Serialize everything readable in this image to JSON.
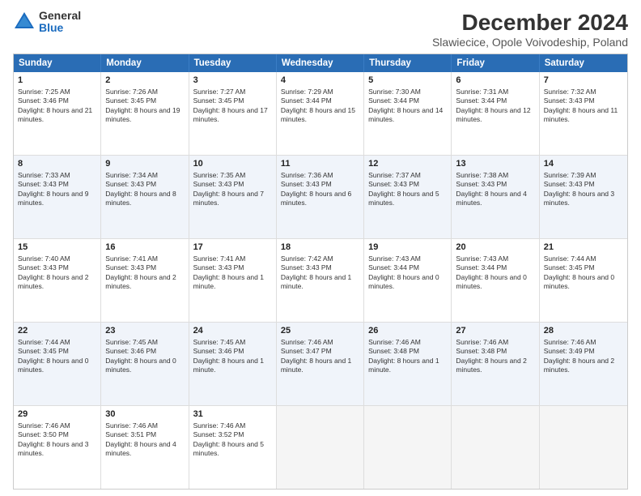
{
  "header": {
    "logo_general": "General",
    "logo_blue": "Blue",
    "main_title": "December 2024",
    "subtitle": "Slawiecice, Opole Voivodeship, Poland"
  },
  "calendar": {
    "days_of_week": [
      "Sunday",
      "Monday",
      "Tuesday",
      "Wednesday",
      "Thursday",
      "Friday",
      "Saturday"
    ],
    "rows": [
      {
        "alt": false,
        "cells": [
          {
            "day": "1",
            "text": "Sunrise: 7:25 AM\nSunset: 3:46 PM\nDaylight: 8 hours and 21 minutes."
          },
          {
            "day": "2",
            "text": "Sunrise: 7:26 AM\nSunset: 3:45 PM\nDaylight: 8 hours and 19 minutes."
          },
          {
            "day": "3",
            "text": "Sunrise: 7:27 AM\nSunset: 3:45 PM\nDaylight: 8 hours and 17 minutes."
          },
          {
            "day": "4",
            "text": "Sunrise: 7:29 AM\nSunset: 3:44 PM\nDaylight: 8 hours and 15 minutes."
          },
          {
            "day": "5",
            "text": "Sunrise: 7:30 AM\nSunset: 3:44 PM\nDaylight: 8 hours and 14 minutes."
          },
          {
            "day": "6",
            "text": "Sunrise: 7:31 AM\nSunset: 3:44 PM\nDaylight: 8 hours and 12 minutes."
          },
          {
            "day": "7",
            "text": "Sunrise: 7:32 AM\nSunset: 3:43 PM\nDaylight: 8 hours and 11 minutes."
          }
        ]
      },
      {
        "alt": true,
        "cells": [
          {
            "day": "8",
            "text": "Sunrise: 7:33 AM\nSunset: 3:43 PM\nDaylight: 8 hours and 9 minutes."
          },
          {
            "day": "9",
            "text": "Sunrise: 7:34 AM\nSunset: 3:43 PM\nDaylight: 8 hours and 8 minutes."
          },
          {
            "day": "10",
            "text": "Sunrise: 7:35 AM\nSunset: 3:43 PM\nDaylight: 8 hours and 7 minutes."
          },
          {
            "day": "11",
            "text": "Sunrise: 7:36 AM\nSunset: 3:43 PM\nDaylight: 8 hours and 6 minutes."
          },
          {
            "day": "12",
            "text": "Sunrise: 7:37 AM\nSunset: 3:43 PM\nDaylight: 8 hours and 5 minutes."
          },
          {
            "day": "13",
            "text": "Sunrise: 7:38 AM\nSunset: 3:43 PM\nDaylight: 8 hours and 4 minutes."
          },
          {
            "day": "14",
            "text": "Sunrise: 7:39 AM\nSunset: 3:43 PM\nDaylight: 8 hours and 3 minutes."
          }
        ]
      },
      {
        "alt": false,
        "cells": [
          {
            "day": "15",
            "text": "Sunrise: 7:40 AM\nSunset: 3:43 PM\nDaylight: 8 hours and 2 minutes."
          },
          {
            "day": "16",
            "text": "Sunrise: 7:41 AM\nSunset: 3:43 PM\nDaylight: 8 hours and 2 minutes."
          },
          {
            "day": "17",
            "text": "Sunrise: 7:41 AM\nSunset: 3:43 PM\nDaylight: 8 hours and 1 minute."
          },
          {
            "day": "18",
            "text": "Sunrise: 7:42 AM\nSunset: 3:43 PM\nDaylight: 8 hours and 1 minute."
          },
          {
            "day": "19",
            "text": "Sunrise: 7:43 AM\nSunset: 3:44 PM\nDaylight: 8 hours and 0 minutes."
          },
          {
            "day": "20",
            "text": "Sunrise: 7:43 AM\nSunset: 3:44 PM\nDaylight: 8 hours and 0 minutes."
          },
          {
            "day": "21",
            "text": "Sunrise: 7:44 AM\nSunset: 3:45 PM\nDaylight: 8 hours and 0 minutes."
          }
        ]
      },
      {
        "alt": true,
        "cells": [
          {
            "day": "22",
            "text": "Sunrise: 7:44 AM\nSunset: 3:45 PM\nDaylight: 8 hours and 0 minutes."
          },
          {
            "day": "23",
            "text": "Sunrise: 7:45 AM\nSunset: 3:46 PM\nDaylight: 8 hours and 0 minutes."
          },
          {
            "day": "24",
            "text": "Sunrise: 7:45 AM\nSunset: 3:46 PM\nDaylight: 8 hours and 1 minute."
          },
          {
            "day": "25",
            "text": "Sunrise: 7:46 AM\nSunset: 3:47 PM\nDaylight: 8 hours and 1 minute."
          },
          {
            "day": "26",
            "text": "Sunrise: 7:46 AM\nSunset: 3:48 PM\nDaylight: 8 hours and 1 minute."
          },
          {
            "day": "27",
            "text": "Sunrise: 7:46 AM\nSunset: 3:48 PM\nDaylight: 8 hours and 2 minutes."
          },
          {
            "day": "28",
            "text": "Sunrise: 7:46 AM\nSunset: 3:49 PM\nDaylight: 8 hours and 2 minutes."
          }
        ]
      },
      {
        "alt": false,
        "cells": [
          {
            "day": "29",
            "text": "Sunrise: 7:46 AM\nSunset: 3:50 PM\nDaylight: 8 hours and 3 minutes."
          },
          {
            "day": "30",
            "text": "Sunrise: 7:46 AM\nSunset: 3:51 PM\nDaylight: 8 hours and 4 minutes."
          },
          {
            "day": "31",
            "text": "Sunrise: 7:46 AM\nSunset: 3:52 PM\nDaylight: 8 hours and 5 minutes."
          },
          {
            "day": "",
            "text": ""
          },
          {
            "day": "",
            "text": ""
          },
          {
            "day": "",
            "text": ""
          },
          {
            "day": "",
            "text": ""
          }
        ]
      }
    ]
  }
}
